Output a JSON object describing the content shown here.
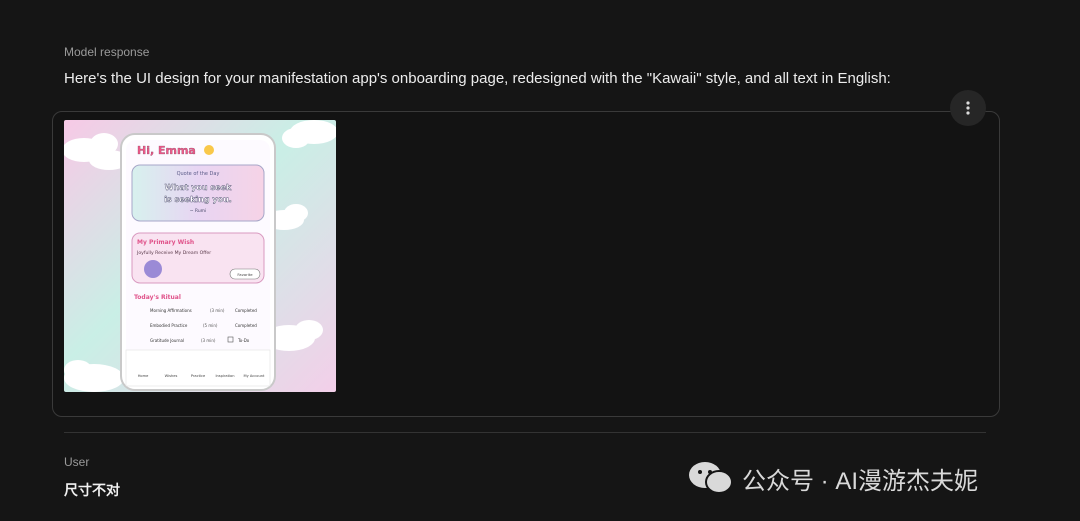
{
  "header": {
    "label": "Model response"
  },
  "response": {
    "text": "Here's the UI design for your manifestation app's onboarding page, redesigned with the \"Kawaii\" style, and all text in English:"
  },
  "image_card": {
    "menu_icon": "more-vertical-icon",
    "phone": {
      "greeting": "Hi, Emma",
      "quote_title": "Quote of the Day",
      "quote_line1": "What you seek",
      "quote_line2": "is seeking you.",
      "quote_author": "~ Rumi",
      "wish_title": "My Primary Wish",
      "wish_text": "Joyfully Receive My Dream Offer",
      "wish_button": "Favorite",
      "ritual_title": "Today's Ritual",
      "rituals": [
        {
          "name": "Morning Affirmations",
          "dur": "(3 min)",
          "status": "Completed"
        },
        {
          "name": "Embodied Practice",
          "dur": "(5 min)",
          "status": "Completed"
        },
        {
          "name": "Gratitude Journal",
          "dur": "(3 min)",
          "status": "To-Do"
        }
      ],
      "nav": [
        "Home",
        "Wishes",
        "Practice",
        "Inspiration",
        "My Account"
      ]
    }
  },
  "user": {
    "label": "User",
    "text": "尺寸不对"
  },
  "watermark": {
    "text": "公众号 · AI漫游杰夫妮"
  }
}
